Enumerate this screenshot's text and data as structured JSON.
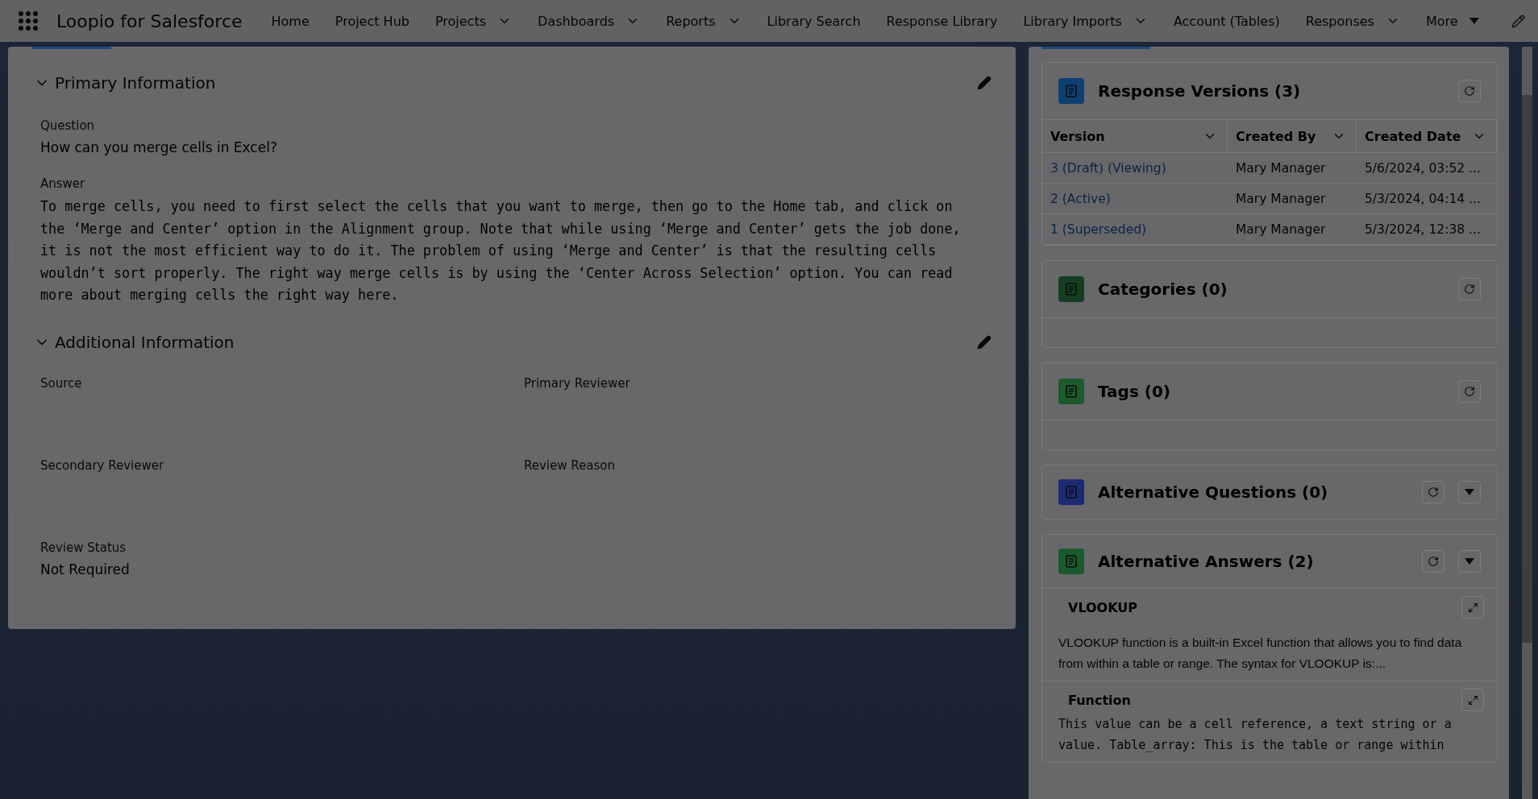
{
  "app": {
    "name": "Loopio for Salesforce"
  },
  "nav": [
    {
      "label": "Home",
      "dropdown": false
    },
    {
      "label": "Project Hub",
      "dropdown": false
    },
    {
      "label": "Projects",
      "dropdown": true
    },
    {
      "label": "Dashboards",
      "dropdown": true
    },
    {
      "label": "Reports",
      "dropdown": true
    },
    {
      "label": "Library Search",
      "dropdown": false
    },
    {
      "label": "Response Library",
      "dropdown": false
    },
    {
      "label": "Library Imports",
      "dropdown": true
    },
    {
      "label": "Account (Tables)",
      "dropdown": false
    },
    {
      "label": "Responses",
      "dropdown": true
    }
  ],
  "nav_more": {
    "label": "More"
  },
  "sections": [
    {
      "title": "Primary Information",
      "expanded": true,
      "kind": "stack",
      "fields": [
        {
          "label": "Question",
          "value": "How can you merge cells in Excel?",
          "kind": "text"
        },
        {
          "label": "Answer",
          "value": "To merge cells, you need to first select the cells that you want to merge, then go to the Home tab, and click on the ‘Merge and Center’ option in the Alignment group. Note that while using ‘Merge and Center’ gets the job done, it is not the most efficient way to do it. The problem of using ‘Merge and Center’ is that the resulting cells wouldn’t sort properly. The right way merge cells is by using the ‘Center Across Selection’ option. You can read more about merging cells the right way here.",
          "kind": "mono"
        }
      ]
    },
    {
      "title": "Additional Information",
      "expanded": true,
      "kind": "grid",
      "fields": [
        {
          "label": "Source",
          "kind": "text"
        },
        {
          "label": "Primary Reviewer",
          "kind": "text"
        },
        {
          "label": "Secondary Reviewer",
          "kind": "text"
        },
        {
          "label": "Review Reason",
          "kind": "text"
        },
        {
          "label": "Review Status",
          "value": "Not Required",
          "kind": "text"
        }
      ]
    }
  ],
  "related": [
    {
      "title": "Response Versions (3)",
      "color": "#0d3f73",
      "kind": "table",
      "menu": false,
      "columns": [
        "Version",
        "Created By",
        "Created Date"
      ],
      "rows": [
        [
          "3 (Draft) (Viewing)",
          "Mary Manager",
          "5/6/2024, 03:52 ..."
        ],
        [
          "2 (Active)",
          "Mary Manager",
          "5/3/2024, 04:14 ..."
        ],
        [
          "1 (Superseded)",
          "Mary Manager",
          "5/3/2024, 12:38 ..."
        ]
      ]
    },
    {
      "title": "Categories (0)",
      "color": "#143d22",
      "kind": "empty",
      "menu": false
    },
    {
      "title": "Tags (0)",
      "color": "#1d5a2c",
      "kind": "empty",
      "menu": false
    },
    {
      "title": "Alternative Questions (0)",
      "color": "#1c2a74",
      "kind": "header",
      "menu": true
    },
    {
      "title": "Alternative Answers (2)",
      "color": "#1b5a2e",
      "kind": "answers",
      "menu": true,
      "items": [
        {
          "title": "VLOOKUP",
          "text": "VLOOKUP function is a built-in Excel function that allows you to find data from within a table or range. The syntax for VLOOKUP is:...",
          "kind": "sans"
        },
        {
          "title": "Function",
          "text": "This value can be a cell reference, a text string or a value. Table_array: This is the table or range within",
          "kind": "mono"
        }
      ]
    }
  ]
}
